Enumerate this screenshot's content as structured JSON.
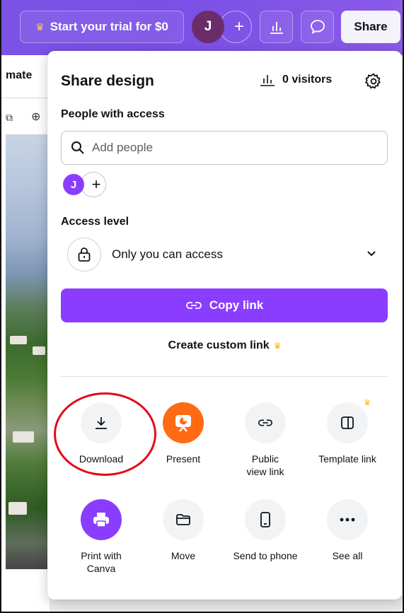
{
  "topbar": {
    "trial_label": "Start your trial for $0",
    "avatar_initial": "J",
    "share_label": "Share"
  },
  "editor": {
    "partial_label": "mate"
  },
  "panel": {
    "title": "Share design",
    "visitors_label": "0 visitors",
    "people_heading": "People with access",
    "add_people_placeholder": "Add people",
    "member_initial": "J",
    "access_heading": "Access level",
    "access_value": "Only you can access",
    "copy_link_label": "Copy link",
    "custom_link_label": "Create custom link",
    "actions": [
      {
        "label": "Download",
        "icon": "download-icon"
      },
      {
        "label": "Present",
        "icon": "present-icon"
      },
      {
        "label": "Public view link",
        "icon": "link-icon"
      },
      {
        "label": "Template link",
        "icon": "template-icon"
      },
      {
        "label": "Print with Canva",
        "icon": "printer-icon"
      },
      {
        "label": "Move",
        "icon": "folder-icon"
      },
      {
        "label": "Send to phone",
        "icon": "phone-icon"
      },
      {
        "label": "See all",
        "icon": "more-icon"
      }
    ]
  },
  "colors": {
    "brand_purple": "#8b3dff",
    "topbar_purple": "#7b52e6",
    "present_orange": "#ff6a13",
    "crown_gold": "#ffb300",
    "highlight_red": "#e30b17"
  }
}
